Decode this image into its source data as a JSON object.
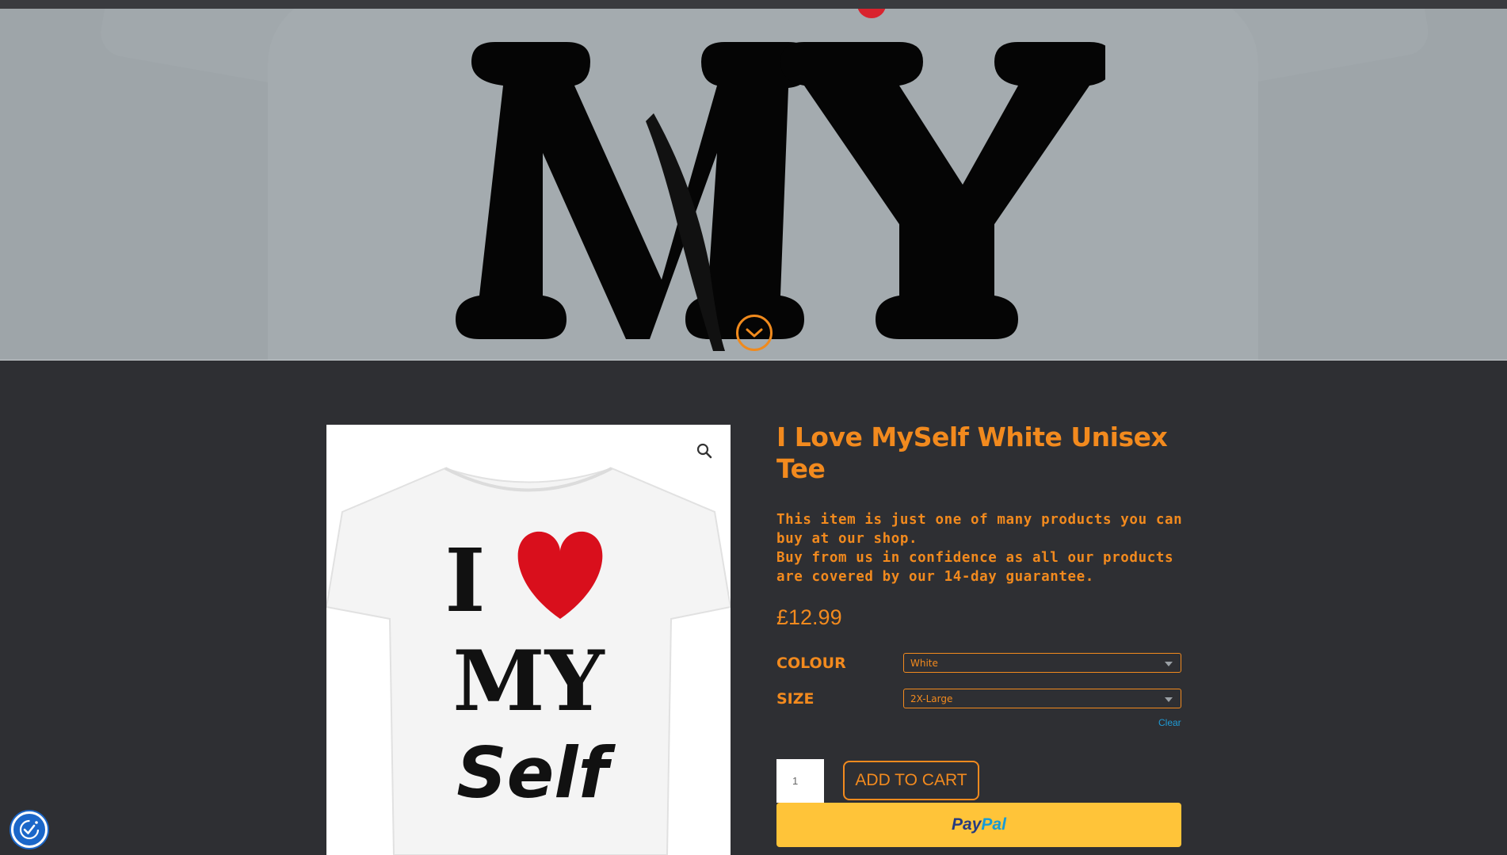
{
  "hero": {
    "scroll_icon": "chevron-down-circle-icon"
  },
  "product": {
    "title": "I Love MySelf White Unisex Tee",
    "description_line1": "This item is just one of many products you can buy at our shop.",
    "description_line2": "Buy from us in confidence as all our products are covered by our 14-day guarantee.",
    "price": "£12.99",
    "image_text_top": "I",
    "image_text_mid": "MY",
    "image_text_bottom": "Self"
  },
  "variations": {
    "colour_label": "COLOUR",
    "colour_value": "White",
    "size_label": "SIZE",
    "size_value": "2X-Large",
    "clear_label": "Clear"
  },
  "cart": {
    "quantity": "1",
    "add_to_cart_label": "ADD TO CART",
    "paypal_label_1": "Pay",
    "paypal_label_2": "Pal"
  },
  "colors": {
    "accent": "#f28a1e",
    "background": "#2e2f33",
    "paypal": "#ffc439",
    "accessibility": "#1b67c9"
  }
}
